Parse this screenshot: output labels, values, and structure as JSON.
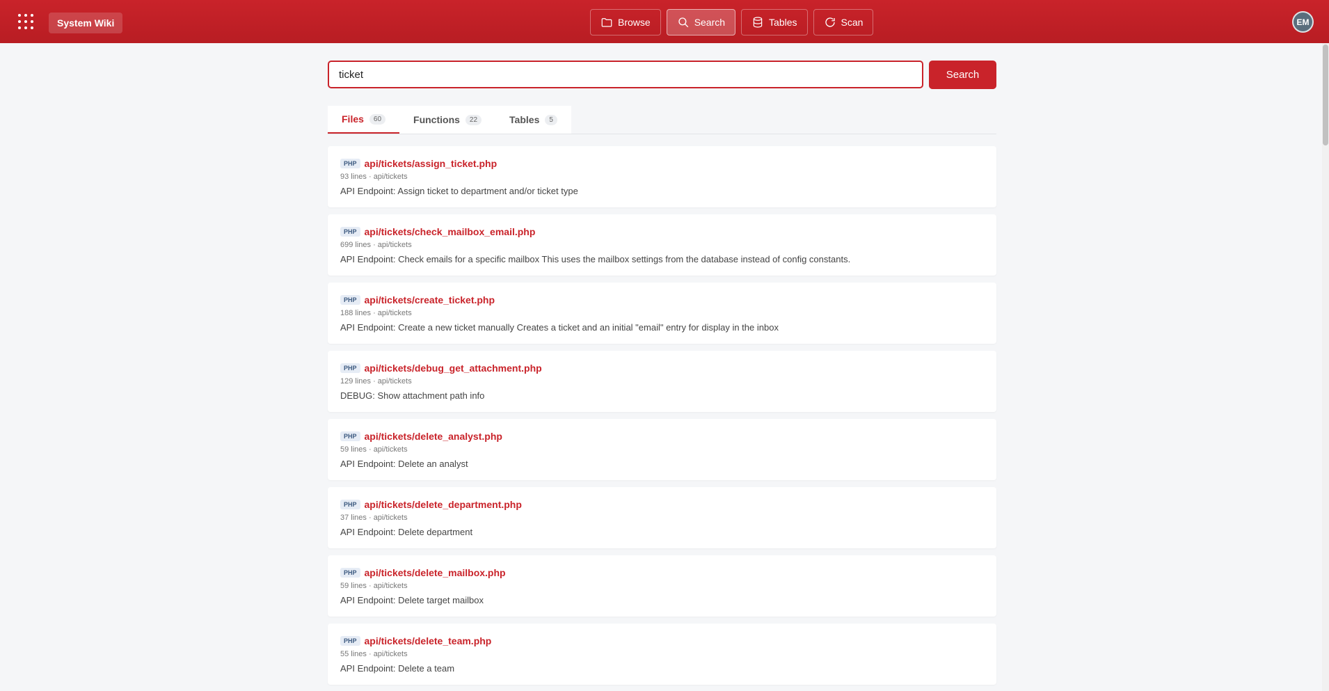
{
  "header": {
    "brand": "System Wiki",
    "nav": [
      {
        "label": "Browse",
        "icon": "folder-icon"
      },
      {
        "label": "Search",
        "icon": "search-icon"
      },
      {
        "label": "Tables",
        "icon": "database-icon"
      },
      {
        "label": "Scan",
        "icon": "refresh-icon"
      }
    ],
    "avatar_initials": "EM"
  },
  "search": {
    "value": "ticket",
    "button_label": "Search"
  },
  "tabs": [
    {
      "label": "Files",
      "count": "60"
    },
    {
      "label": "Functions",
      "count": "22"
    },
    {
      "label": "Tables",
      "count": "5"
    }
  ],
  "results": [
    {
      "badge": "PHP",
      "title": "api/tickets/assign_ticket.php",
      "meta": "93 lines · api/tickets",
      "desc": "API Endpoint: Assign ticket to department and/or ticket type"
    },
    {
      "badge": "PHP",
      "title": "api/tickets/check_mailbox_email.php",
      "meta": "699 lines · api/tickets",
      "desc": "API Endpoint: Check emails for a specific mailbox This uses the mailbox settings from the database instead of config constants."
    },
    {
      "badge": "PHP",
      "title": "api/tickets/create_ticket.php",
      "meta": "188 lines · api/tickets",
      "desc": "API Endpoint: Create a new ticket manually Creates a ticket and an initial \"email\" entry for display in the inbox"
    },
    {
      "badge": "PHP",
      "title": "api/tickets/debug_get_attachment.php",
      "meta": "129 lines · api/tickets",
      "desc": "DEBUG: Show attachment path info"
    },
    {
      "badge": "PHP",
      "title": "api/tickets/delete_analyst.php",
      "meta": "59 lines · api/tickets",
      "desc": "API Endpoint: Delete an analyst"
    },
    {
      "badge": "PHP",
      "title": "api/tickets/delete_department.php",
      "meta": "37 lines · api/tickets",
      "desc": "API Endpoint: Delete department"
    },
    {
      "badge": "PHP",
      "title": "api/tickets/delete_mailbox.php",
      "meta": "59 lines · api/tickets",
      "desc": "API Endpoint: Delete target mailbox"
    },
    {
      "badge": "PHP",
      "title": "api/tickets/delete_team.php",
      "meta": "55 lines · api/tickets",
      "desc": "API Endpoint: Delete a team"
    }
  ],
  "colors": {
    "accent": "#c9232a",
    "header": "#c01f26"
  }
}
